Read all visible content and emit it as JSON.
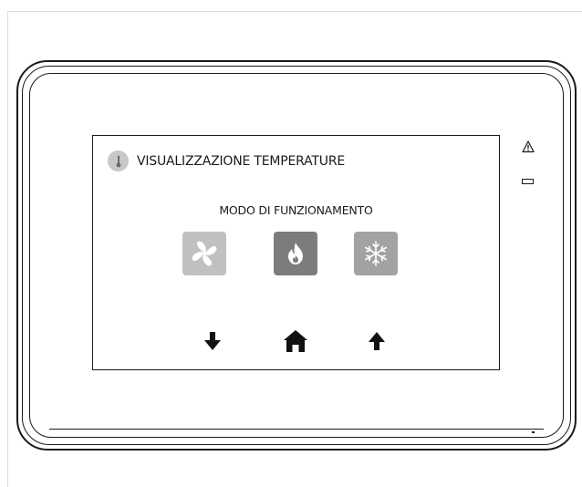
{
  "screen": {
    "title": "VISUALIZZAZIONE TEMPERATURE",
    "mode_label": "MODO DI FUNZIONAMENTO",
    "modes": [
      {
        "name": "fan",
        "icon": "fan-icon",
        "color": "#c0c0c0"
      },
      {
        "name": "heat",
        "icon": "flame-icon",
        "color": "#7c7c7c"
      },
      {
        "name": "cool",
        "icon": "snowflake-icon",
        "color": "#a2a2a2"
      }
    ],
    "nav": [
      {
        "name": "down",
        "icon": "arrow-down-icon"
      },
      {
        "name": "home",
        "icon": "home-icon"
      },
      {
        "name": "up",
        "icon": "arrow-up-icon"
      }
    ]
  },
  "device": {
    "indicators": [
      "warning-icon",
      "led-indicator"
    ]
  }
}
